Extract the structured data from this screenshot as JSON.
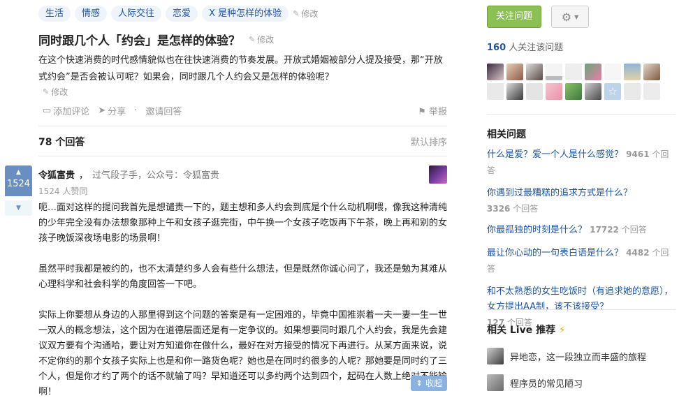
{
  "topics": [
    "生活",
    "情感",
    "人际交往",
    "恋爱",
    "X 是种怎样的体验"
  ],
  "edit_label": "修改",
  "question": {
    "title": "同时跟几个人「约会」是怎样的体验？",
    "description": "在这个快速消费的时代感情貌似也在往快速消费的节奏发展。开放式婚姻被部分人提及接受，那“开放式约会”是否会被认可呢？如果会，同时跟几个人约会又是怎样的体验呢？",
    "actions": {
      "comment": "添加评论",
      "share": "分享",
      "invite": "邀请回答",
      "report": "举报"
    }
  },
  "answers": {
    "count_label": "78 个回答",
    "sort_label": "默认排序"
  },
  "answer": {
    "votes": "1524",
    "author_name": "令狐富贵",
    "author_bio": "过气段子手，公众号：令狐富贵",
    "agree_label": "1524 人赞同",
    "paragraphs": [
      "呃…面对这样的提问我首先是想谴责一下的，题主想和多人约会到底是个什么动机啊喂，像我这种清纯的少年完全没有办法想象那种上午和女孩子逛完街，中午换一个女孩子吃饭再下午茶，晚上再和别的女孩子晚饭深夜场电影的场景啊！",
      "虽然平时我都是被约的，也不太清楚约多人会有些什么想法，但是既然你诚心问了，我还是勉为其难从心理科学和社会科学的角度回答一下吧。",
      "实际上你要想从身边的人那里得到这个问题的答案是有一定困难的，毕竟中国推崇着一夫一妻一生一世一双人的概念想法，这个因为在道德层面还是有一定争议的。如果想要同时跟几个人约会，我是先会建议双方要有个沟通哈，要让对方知道你在做什么，最好在对方接受的情况下再进行。从某方面来说，说不定你约的那个女孩子实际上也是和你一路货色呢？她也是在同时约很多的人呢？那她要是同时约了三个人，但是你才约了两个的话不就输了吗？早知道还可以多约两个达到四个，起码在人数上绝对不能输啊！"
    ],
    "collapse_label": "收起"
  },
  "sidebar": {
    "follow_label": "关注问题",
    "followers_count": "160",
    "followers_suffix": " 人关注该问题",
    "related_title": "相关问题",
    "related": [
      {
        "q": "什么是爱？爱一个人是什么感觉？",
        "count": "9461",
        "suffix": " 个回答"
      },
      {
        "q": "你遇到过最糟糕的追求方式是什么？",
        "count": "3326",
        "suffix": " 个回答"
      },
      {
        "q": "你最孤独的时刻是什么？",
        "count": "17722",
        "suffix": " 个回答"
      },
      {
        "q": "最让你心动的一句表白语是什么？",
        "count": "4482",
        "suffix": " 个回答"
      },
      {
        "q": "和不太熟悉的女生吃饭时（有追求她的意愿），女方提出AA制，该不该接受？",
        "count": "127",
        "suffix": " 个回答"
      }
    ],
    "live_title": "相关 Live 推荐",
    "lives": [
      "异地恋，这一段独立而丰盛的旅程",
      "程序员的常见陋习"
    ]
  },
  "colors": {
    "accent": "#225599",
    "follow_green": "#8ac054",
    "vote_blue": "#698ebf"
  }
}
